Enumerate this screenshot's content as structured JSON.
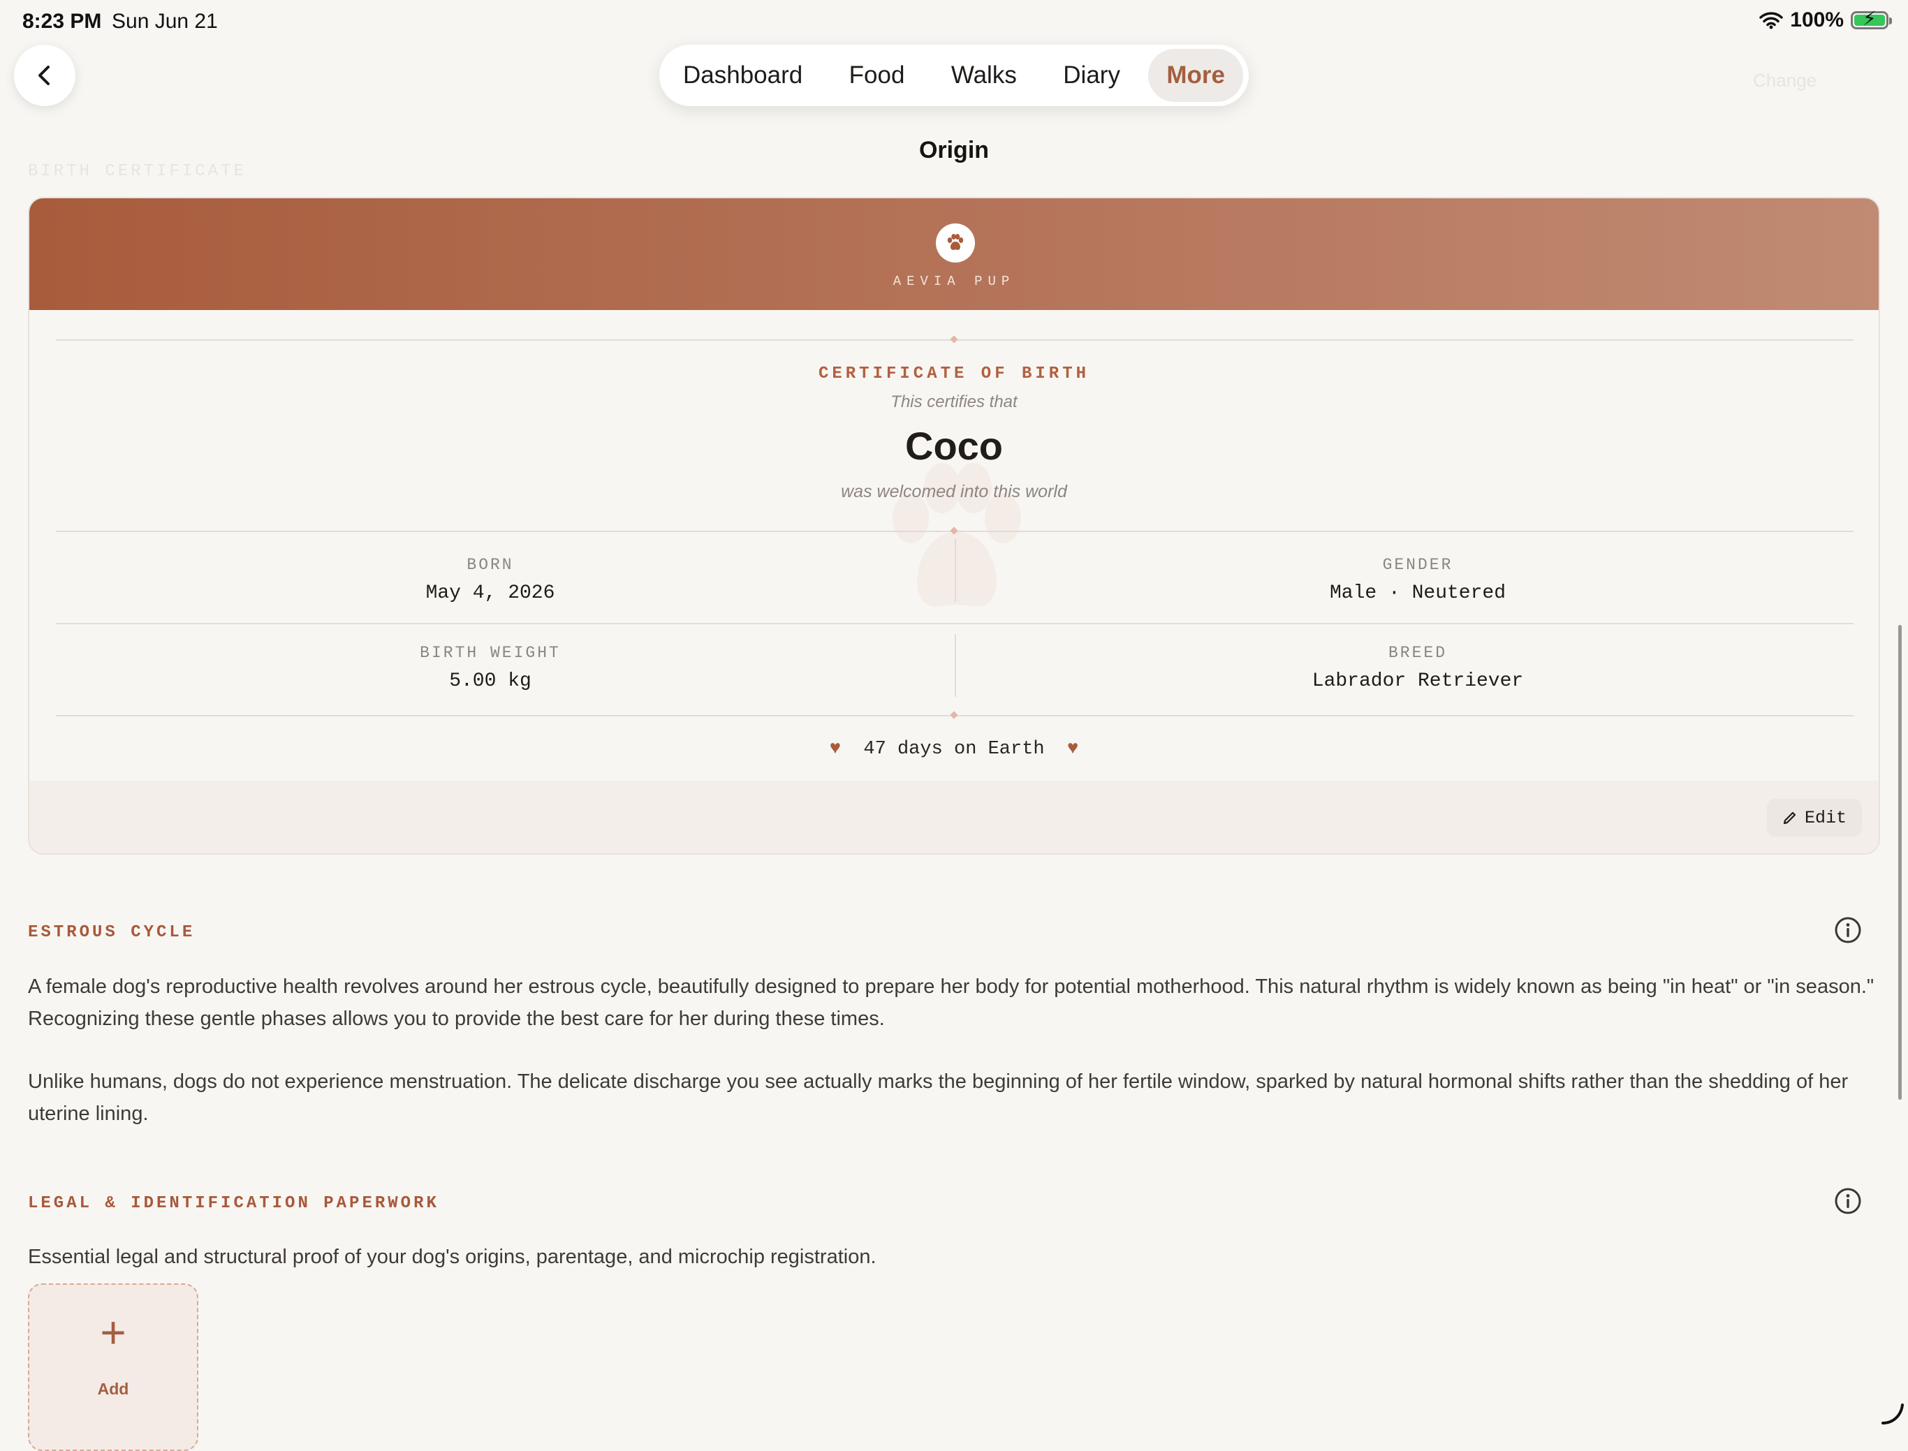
{
  "status_bar": {
    "time": "8:23 PM",
    "date": "Sun Jun 21",
    "battery": "100%"
  },
  "nav": {
    "tabs": [
      "Dashboard",
      "Food",
      "Walks",
      "Diary",
      "More"
    ],
    "active_tab": "More",
    "ghost_action": "Change"
  },
  "page": {
    "title": "Origin",
    "section_label": "BIRTH CERTIFICATE"
  },
  "certificate": {
    "brand": "AEVIA PUP",
    "title": "CERTIFICATE OF BIRTH",
    "certifies_text": "This certifies that",
    "pet_name": "Coco",
    "welcomed_text": "was welcomed into this world",
    "born_label": "BORN",
    "born_value": "May 4, 2026",
    "gender_label": "GENDER",
    "gender_value": "Male · Neutered",
    "weight_label": "BIRTH WEIGHT",
    "weight_value": "5.00 kg",
    "breed_label": "BREED",
    "breed_value": "Labrador Retriever",
    "days_text": "47 days on Earth",
    "edit_label": "Edit"
  },
  "estrous": {
    "title": "ESTROUS CYCLE",
    "para1": "A female dog's reproductive health revolves around her estrous cycle, beautifully designed to prepare her body for potential motherhood. This natural rhythm is widely known as being \"in heat\" or \"in season.\" Recognizing these gentle phases allows you to provide the best care for her during these times.",
    "para2": "Unlike humans, dogs do not experience menstruation. The delicate discharge you see actually marks the beginning of her fertile window, sparked by natural hormonal shifts rather than the shedding of her uterine lining."
  },
  "legal": {
    "title": "LEGAL & IDENTIFICATION PAPERWORK",
    "description": "Essential legal and structural proof of your dog's origins, parentage, and microchip registration.",
    "add_label": "Add"
  },
  "colors": {
    "accent": "#a35f40",
    "header_start": "#a85c3c",
    "header_end": "#c08a73",
    "background": "#f8f6f3"
  }
}
